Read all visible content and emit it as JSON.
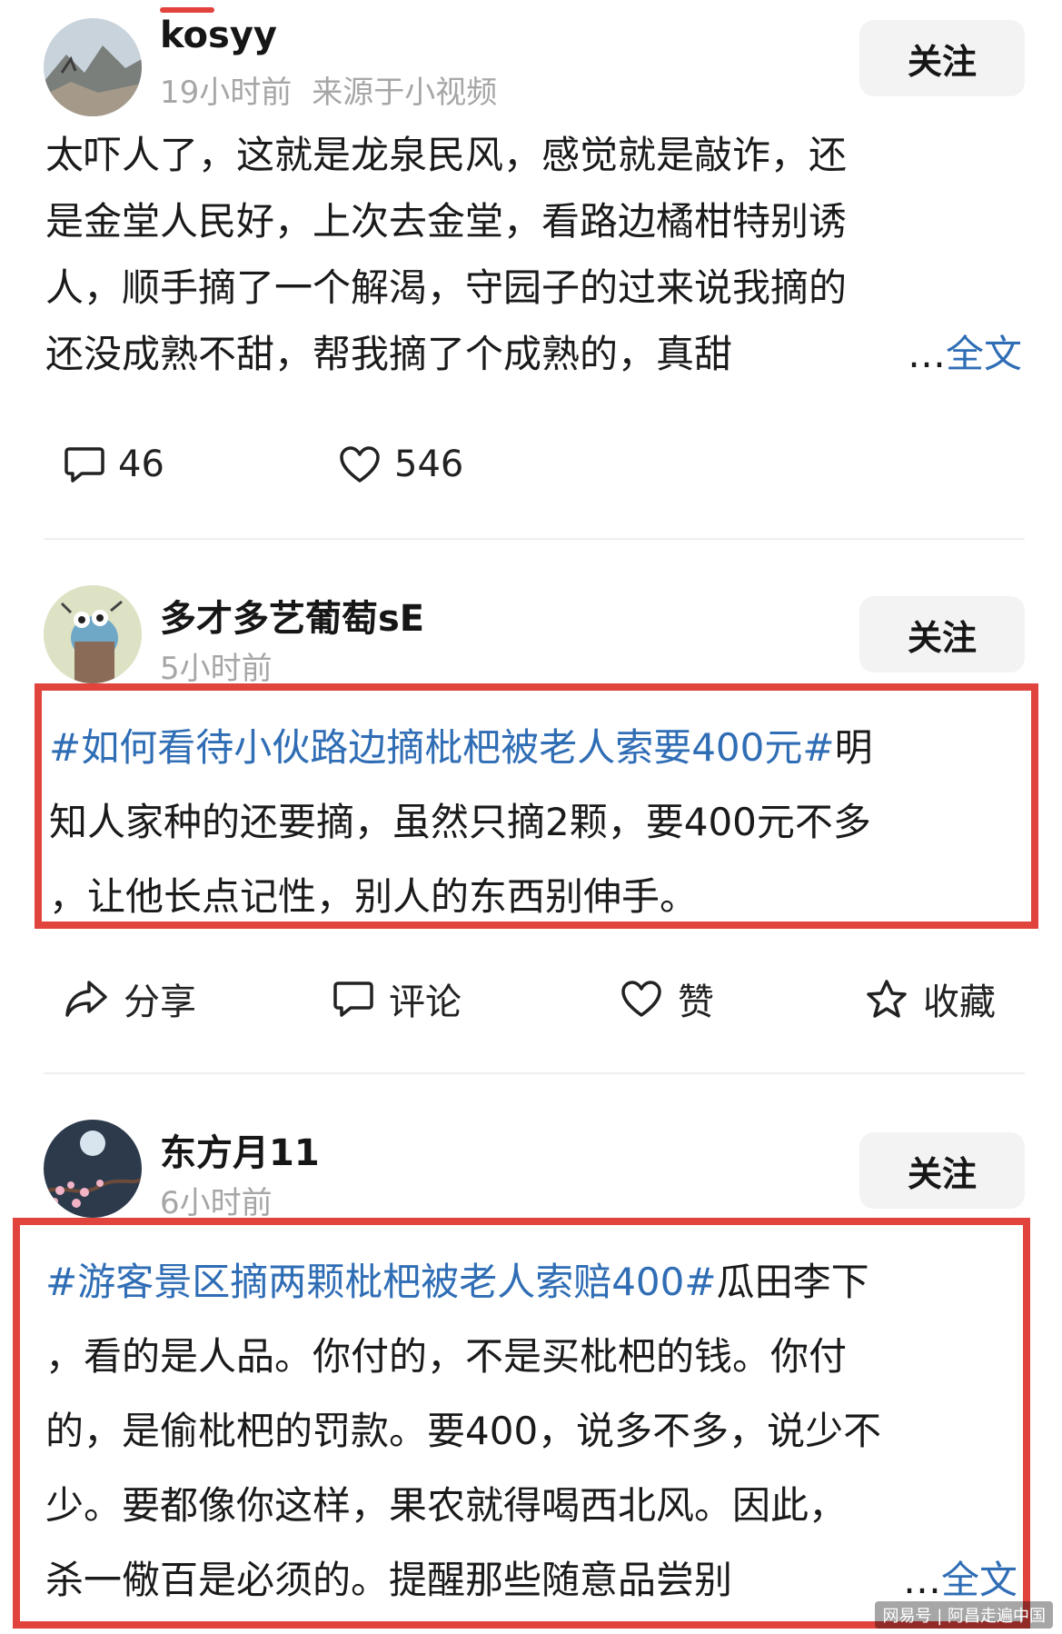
{
  "posts": [
    {
      "username": "kosyy",
      "time": "19小时前",
      "source": "来源于小视频",
      "follow_label": "关注",
      "text_lines": [
        "太吓人了，这就是龙泉民风，感觉就是敲诈，还",
        "是金堂人民好，上次去金堂，看路边橘柑特别诱",
        "人，顺手摘了一个解渴，守园子的过来说我摘的",
        "还没成熟不甜，帮我摘了个成熟的，真甜"
      ],
      "ellipsis": "…",
      "more_label": "全文",
      "comments": "46",
      "likes": "546"
    },
    {
      "username": "多才多艺葡萄sE",
      "time": "5小时前",
      "follow_label": "关注",
      "hashtag": "#如何看待小伙路边摘枇杷被老人索要400元#",
      "line1_rest": "明",
      "line2": "知人家种的还要摘，虽然只摘2颗，要400元不多",
      "line3": "，让他长点记性，别人的东西别伸手。",
      "actions": {
        "share": "分享",
        "comment": "评论",
        "like": "赞",
        "favorite": "收藏"
      }
    },
    {
      "username": "东方月11",
      "time": "6小时前",
      "follow_label": "关注",
      "hashtag": "#游客景区摘两颗枇杷被老人索赔400#",
      "line1_rest": "瓜田李下",
      "line2": "，看的是人品。你付的，不是买枇杷的钱。你付",
      "line3": "的，是偷枇杷的罚款。要400，说多不多，说少不",
      "line4": "少。要都像你这样，果农就得喝西北风。因此，",
      "line5": "杀一儆百是必须的。提醒那些随意品尝别",
      "ellipsis": "…",
      "more_label": "全文"
    }
  ],
  "watermark": "网易号 | 阿昌走遍中国",
  "colors": {
    "link": "#2f6db5",
    "highlight_box": "#e1433d",
    "meta": "#a6a6a6"
  }
}
